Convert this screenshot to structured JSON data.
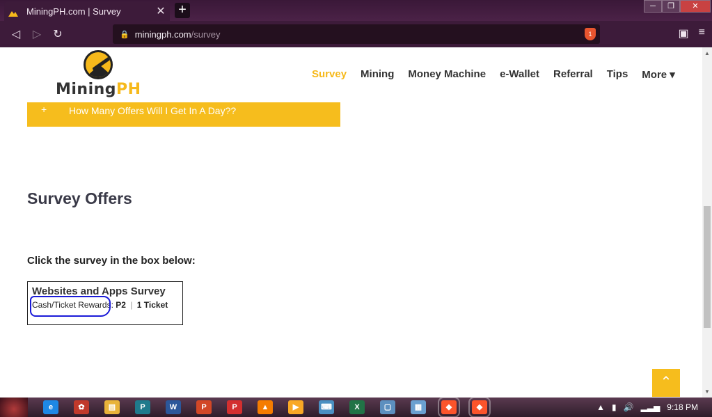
{
  "browser": {
    "tab_title": "MiningPH.com | Survey",
    "tab_close": "✕",
    "new_tab": "+",
    "url_domain": "miningph.com",
    "url_path": "/survey",
    "shield_badge": "1"
  },
  "site": {
    "logo_text_main": "Mining",
    "logo_text_accent": "PH",
    "menu": [
      "Survey",
      "Mining",
      "Money Machine",
      "e-Wallet",
      "Referral",
      "Tips",
      "More ▾"
    ],
    "active_menu": "Survey"
  },
  "content": {
    "accordion_plus": "+",
    "accordion_question": "How Many Offers Will I Get In A Day??",
    "section_title": "Survey Offers",
    "instruction": "Click the survey in the box below:",
    "survey": {
      "title": "Websites and Apps Survey",
      "reward_label": "Cash/Ticket Rewards:",
      "cash_reward": "P2",
      "separator": "|",
      "ticket_reward": "1 Ticket"
    },
    "scroll_top_icon": "⌃"
  },
  "taskbar": {
    "clock": "9:18 PM",
    "icons": [
      {
        "name": "ie-icon",
        "glyph": "e",
        "color": "#1e88e5"
      },
      {
        "name": "app-icon",
        "glyph": "✿",
        "color": "#c0392b"
      },
      {
        "name": "explorer-icon",
        "glyph": "▤",
        "color": "#e8b33a"
      },
      {
        "name": "publisher-icon",
        "glyph": "P",
        "color": "#1f7a8c"
      },
      {
        "name": "word-icon",
        "glyph": "W",
        "color": "#2b579a"
      },
      {
        "name": "powerpoint-icon",
        "glyph": "P",
        "color": "#d24726"
      },
      {
        "name": "pdf-icon",
        "glyph": "P",
        "color": "#d32f2f"
      },
      {
        "name": "vlc-icon",
        "glyph": "▲",
        "color": "#f57c00"
      },
      {
        "name": "media-icon",
        "glyph": "▶",
        "color": "#f9a825"
      },
      {
        "name": "keyboard-icon",
        "glyph": "⌨",
        "color": "#4a90c2"
      },
      {
        "name": "excel-icon",
        "glyph": "X",
        "color": "#217346"
      },
      {
        "name": "window-icon",
        "glyph": "▢",
        "color": "#5c8fbf"
      },
      {
        "name": "calculator-icon",
        "glyph": "▦",
        "color": "#6aa0d0"
      },
      {
        "name": "brave-icon",
        "glyph": "◆",
        "color": "#fb542b"
      },
      {
        "name": "brave-icon-active",
        "glyph": "◆",
        "color": "#fb542b"
      }
    ]
  }
}
